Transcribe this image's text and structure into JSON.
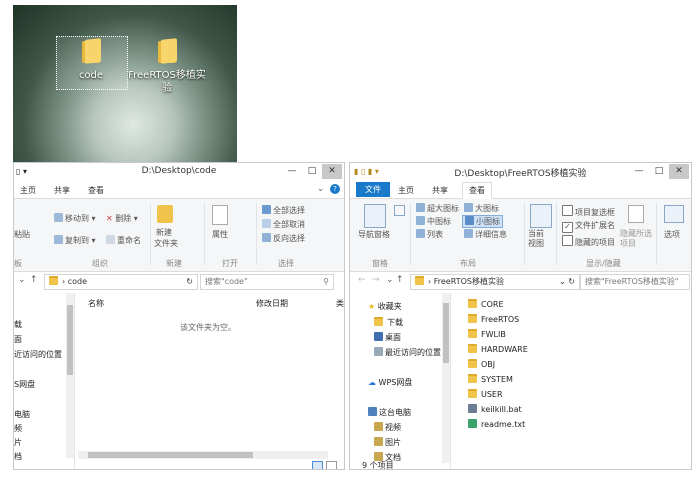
{
  "desktop": {
    "icons": [
      {
        "label": "code"
      },
      {
        "label": "FreeRTOS移植实验"
      }
    ]
  },
  "left_window": {
    "title": "D:\\Desktop\\code",
    "tabs": [
      "主页",
      "共享",
      "查看"
    ],
    "ribbon": {
      "items": [
        "移动到",
        "删除",
        "复制到",
        "重命名",
        "新建",
        "文件夹",
        "属性",
        "全部选择",
        "全部取消",
        "反向选择",
        "粘贴"
      ],
      "groups": [
        "板",
        "组织",
        "新建",
        "打开",
        "选择"
      ]
    },
    "address": "code",
    "search_placeholder": "搜索\"code\"",
    "nav_items": [
      "载",
      "面",
      "近访问的位置",
      "S网盘",
      "电脑",
      "频",
      "片",
      "档"
    ],
    "columns": [
      "名称",
      "修改日期",
      "类"
    ],
    "empty_text": "该文件夹为空。"
  },
  "right_window": {
    "title": "D:\\Desktop\\FreeRTOS移植实验",
    "tabs": [
      "文件",
      "主页",
      "共享",
      "查看"
    ],
    "ribbon": {
      "nav_pane": "导航窗格",
      "layout_items": [
        "超大图标",
        "大图标",
        "中图标",
        "小图标",
        "列表",
        "详细信息"
      ],
      "sort": "当前视图",
      "show": [
        "项目复选框",
        "文件扩展名",
        "隐藏的项目"
      ],
      "hide_selected": "隐藏所选项目",
      "options": "选项",
      "groups": [
        "窗格",
        "布局",
        "当前视图",
        "显示/隐藏"
      ]
    },
    "address": "FreeRTOS移植实验",
    "search_placeholder": "搜索\"FreeRTOS移植实验\"",
    "nav_items": [
      "收藏夹",
      "下载",
      "桌面",
      "最近访问的位置",
      "WPS网盘",
      "这台电脑",
      "视频",
      "图片",
      "文档"
    ],
    "files": [
      "CORE",
      "FreeRTOS",
      "FWLIB",
      "HARDWARE",
      "OBJ",
      "SYSTEM",
      "USER",
      "keilkill.bat",
      "readme.txt"
    ],
    "status": "9 个项目"
  },
  "colors": {
    "accent": "#1979ca",
    "folder": "#f0c44a"
  }
}
